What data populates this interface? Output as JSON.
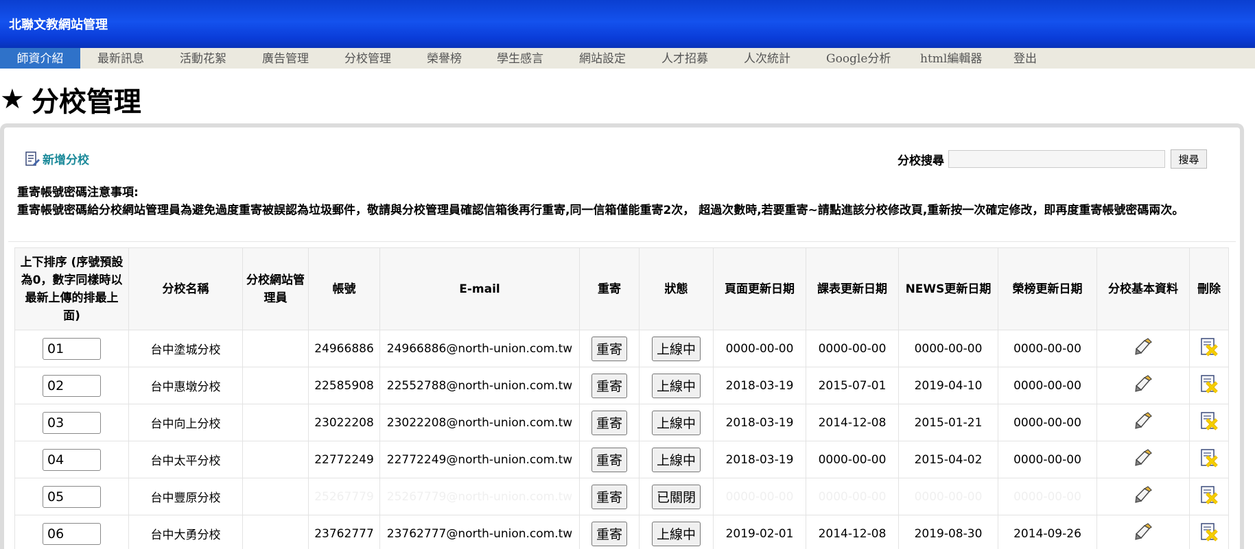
{
  "header": {
    "title": "北聯文教網站管理"
  },
  "nav": {
    "items": [
      {
        "label": "師資介紹",
        "active": true
      },
      {
        "label": "最新訊息"
      },
      {
        "label": "活動花絮"
      },
      {
        "label": "廣告管理"
      },
      {
        "label": "分校管理"
      },
      {
        "label": "榮譽榜"
      },
      {
        "label": "學生感言"
      },
      {
        "label": "網站設定"
      },
      {
        "label": "人才招募"
      },
      {
        "label": "人次統計"
      },
      {
        "label": "Google分析"
      },
      {
        "label": "html編輯器"
      },
      {
        "label": "登出"
      }
    ]
  },
  "page": {
    "title": "分校管理",
    "star_icon": "★"
  },
  "toolbar": {
    "add_label": "新增分校",
    "search_label": "分校搜尋",
    "search_button": "搜尋",
    "search_value": ""
  },
  "notice": {
    "heading": "重寄帳號密碼注意事項:",
    "body": "重寄帳號密碼給分校網站管理員為避免過度重寄被誤認為垃圾郵件，敬請與分校管理員確認信箱後再行重寄,同一信箱僅能重寄2次， 超過次數時,若要重寄~請點進該分校修改頁,重新按一次確定修改，即再度重寄帳號密碼兩次。"
  },
  "table": {
    "headers": {
      "order": "上下排序 (序號預設為0，數字同樣時以最新上傳的排最上面)",
      "name": "分校名稱",
      "admin": "分校網站管理員",
      "account": "帳號",
      "email": "E-mail",
      "resend": "重寄",
      "status": "狀態",
      "page_date": "頁面更新日期",
      "schedule_date": "課表更新日期",
      "news_date": "NEWS更新日期",
      "honor_date": "榮榜更新日期",
      "info": "分校基本資料",
      "delete": "刪除"
    },
    "rows": [
      {
        "order": "01",
        "name": "台中塗城分校",
        "admin": "",
        "account": "24966886",
        "email": "24966886@north-union.com.tw",
        "resend": "重寄",
        "status": "上線中",
        "page_date": "0000-00-00",
        "schedule_date": "0000-00-00",
        "news_date": "0000-00-00",
        "honor_date": "0000-00-00"
      },
      {
        "order": "02",
        "name": "台中惠墩分校",
        "admin": "",
        "account": "22585908",
        "email": "22552788@north-union.com.tw",
        "resend": "重寄",
        "status": "上線中",
        "page_date": "2018-03-19",
        "schedule_date": "2015-07-01",
        "news_date": "2019-04-10",
        "honor_date": "0000-00-00"
      },
      {
        "order": "03",
        "name": "台中向上分校",
        "admin": "",
        "account": "23022208",
        "email": "23022208@north-union.com.tw",
        "resend": "重寄",
        "status": "上線中",
        "page_date": "2018-03-19",
        "schedule_date": "2014-12-08",
        "news_date": "2015-01-21",
        "honor_date": "0000-00-00"
      },
      {
        "order": "04",
        "name": "台中太平分校",
        "admin": "",
        "account": "22772249",
        "email": "22772249@north-union.com.tw",
        "resend": "重寄",
        "status": "上線中",
        "page_date": "2018-03-19",
        "schedule_date": "0000-00-00",
        "news_date": "2015-04-02",
        "honor_date": "0000-00-00"
      },
      {
        "order": "05",
        "name": "台中豐原分校",
        "admin": "",
        "account": "25267779",
        "email": "25267779@north-union.com.tw",
        "resend": "重寄",
        "status": "已關閉",
        "page_date": "0000-00-00",
        "schedule_date": "0000-00-00",
        "news_date": "0000-00-00",
        "honor_date": "0000-00-00",
        "faded": true
      },
      {
        "order": "06",
        "name": "台中大勇分校",
        "admin": "",
        "account": "23762777",
        "email": "23762777@north-union.com.tw",
        "resend": "重寄",
        "status": "上線中",
        "page_date": "2019-02-01",
        "schedule_date": "2014-12-08",
        "news_date": "2019-08-30",
        "honor_date": "2014-09-26"
      }
    ]
  },
  "icons": {
    "add": "document-edit-icon",
    "info": "edit-pencil-icon",
    "delete": "delete-x-icon"
  },
  "colors": {
    "header_blue": "#1452ee",
    "nav_active": "#2f72c9",
    "nav_bg": "#ebe9df",
    "add_link": "#1c8a9a"
  }
}
